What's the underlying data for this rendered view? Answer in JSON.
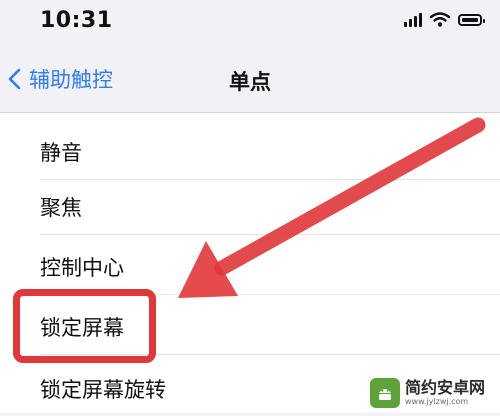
{
  "status_bar": {
    "time": "10:31"
  },
  "nav": {
    "back_label": "辅助触控",
    "title": "单点"
  },
  "list": {
    "items": [
      {
        "label": "静音"
      },
      {
        "label": "聚焦"
      },
      {
        "label": "控制中心"
      },
      {
        "label": "锁定屏幕"
      },
      {
        "label": "锁定屏幕旋转"
      }
    ]
  },
  "annotation": {
    "color": "#e0373a",
    "highlighted_item": "锁定屏幕"
  },
  "watermark": {
    "name": "简约安卓网",
    "url": "www.jylzwj.com"
  },
  "colors": {
    "accent": "#2f7cf6",
    "background": "#f2f2f6"
  }
}
